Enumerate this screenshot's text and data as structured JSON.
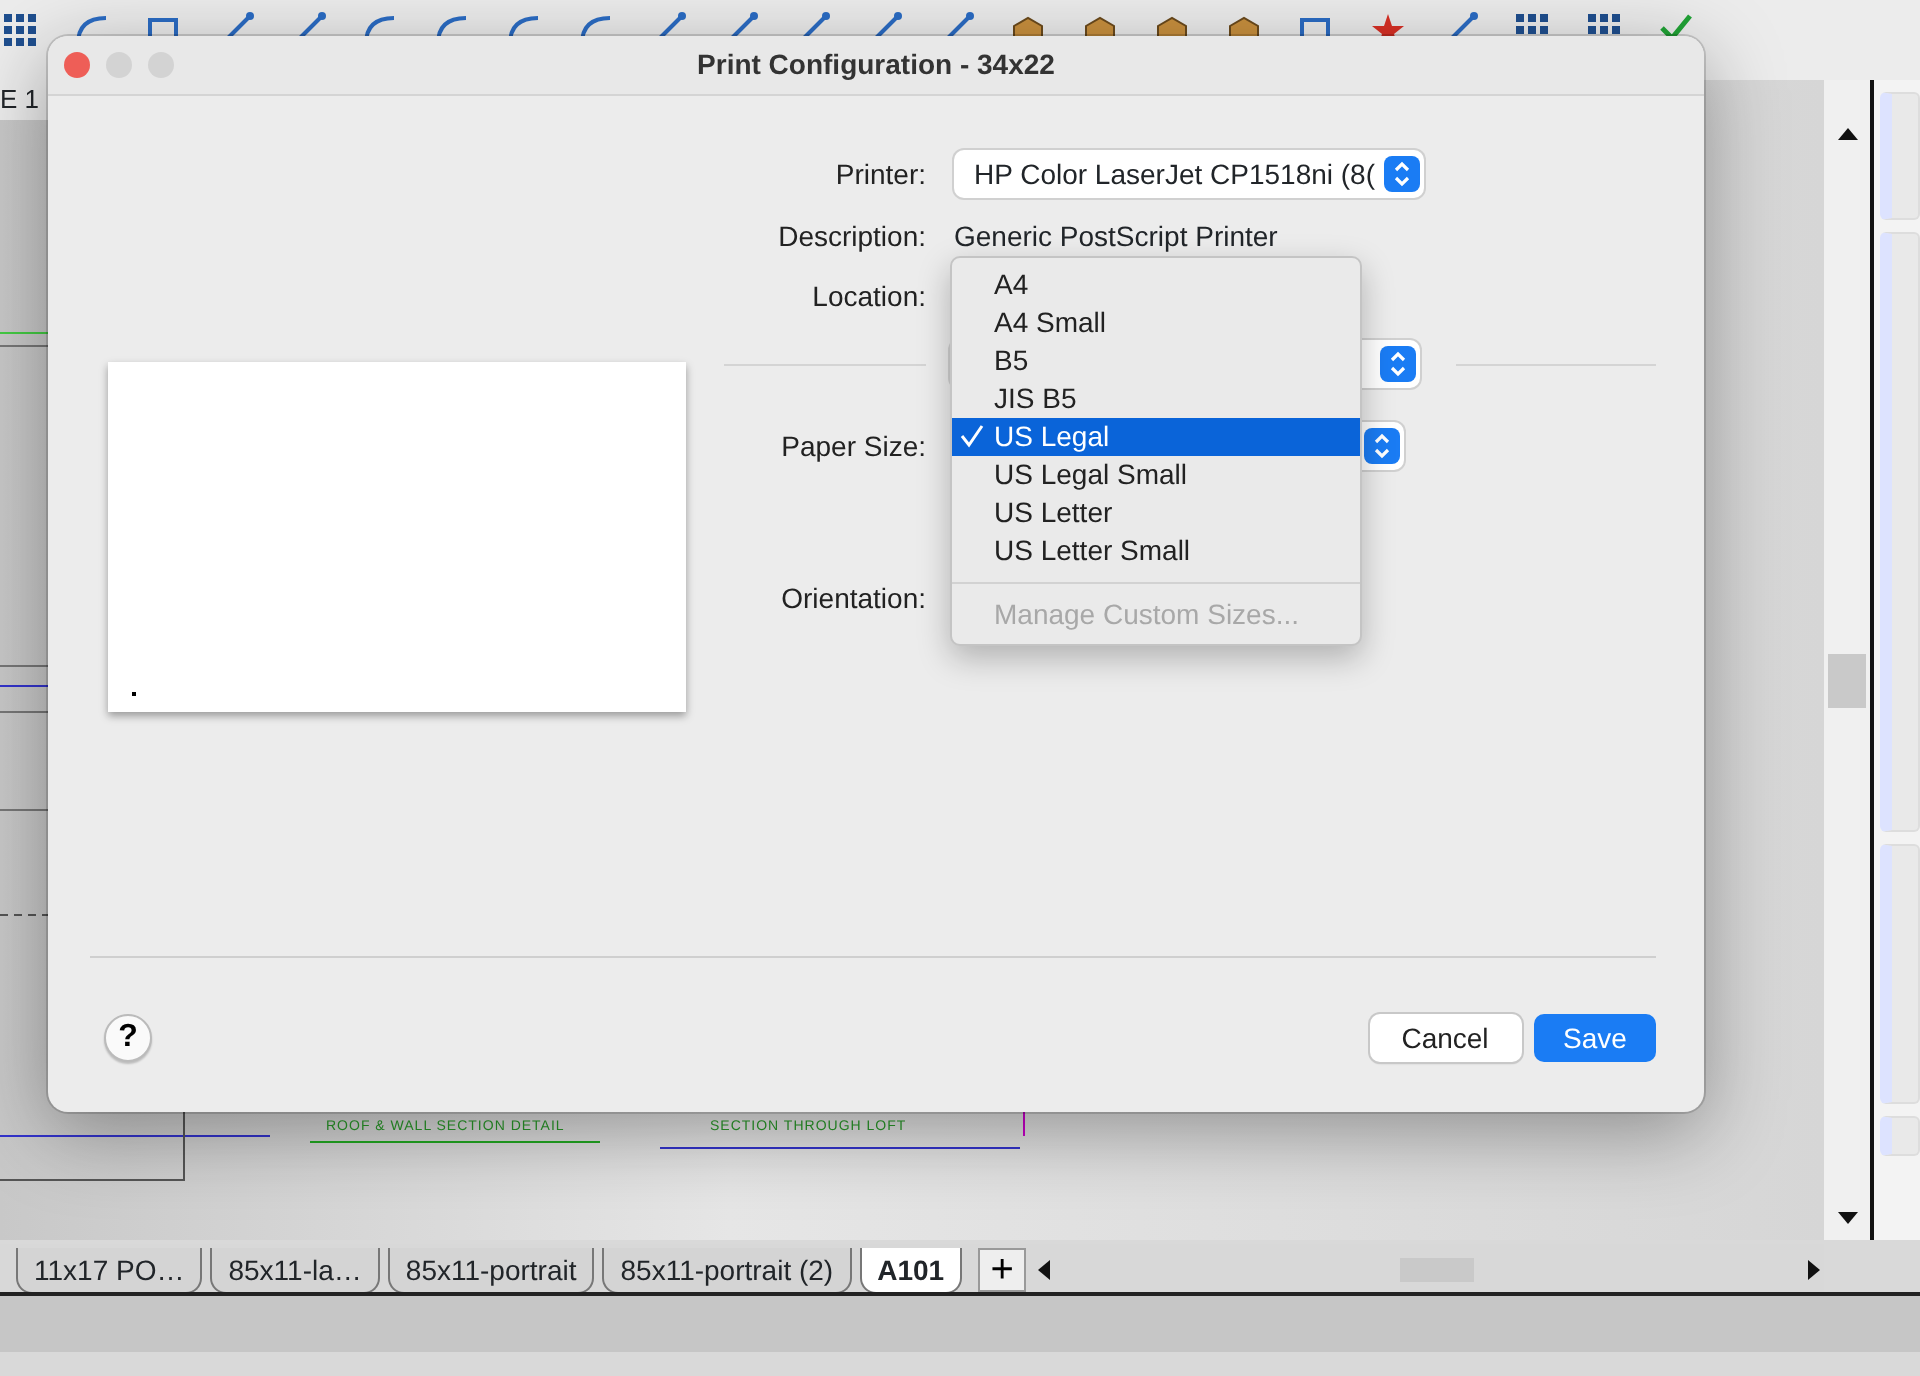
{
  "app": {
    "sheet_label": "E 1",
    "drawing_labels": [
      "ROOF & WALL SECTION DETAIL",
      "SECTION THROUGH LOFT"
    ],
    "sheet_tabs": [
      {
        "label": "11x17 PO…",
        "selected": false
      },
      {
        "label": "85x11-la…",
        "selected": false
      },
      {
        "label": "85x11-portrait",
        "selected": false
      },
      {
        "label": "85x11-portrait (2)",
        "selected": false
      },
      {
        "label": "A101",
        "selected": true
      }
    ],
    "add_tab": "+"
  },
  "dialog": {
    "title": "Print Configuration - 34x22",
    "printer": {
      "label": "Printer:",
      "value": "HP Color LaserJet CP1518ni (8("
    },
    "description": {
      "label": "Description:",
      "value": "Generic PostScript Printer"
    },
    "location": {
      "label": "Location:"
    },
    "paper_size": {
      "label": "Paper Size:"
    },
    "orientation": {
      "label": "Orientation:"
    },
    "paper_menu": [
      {
        "label": "A4",
        "selected": false,
        "disabled": false
      },
      {
        "label": "A4 Small",
        "selected": false,
        "disabled": false
      },
      {
        "label": "B5",
        "selected": false,
        "disabled": false
      },
      {
        "label": "JIS B5",
        "selected": false,
        "disabled": false
      },
      {
        "label": "US Legal",
        "selected": true,
        "disabled": false
      },
      {
        "label": "US Legal Small",
        "selected": false,
        "disabled": false
      },
      {
        "label": "US Letter",
        "selected": false,
        "disabled": false
      },
      {
        "label": "US Letter Small",
        "selected": false,
        "disabled": false
      },
      {
        "kind": "separator"
      },
      {
        "label": "Manage Custom Sizes...",
        "selected": false,
        "disabled": true
      }
    ],
    "help": "?",
    "buttons": [
      {
        "label": "Cancel",
        "kind": "normal"
      },
      {
        "label": "Save",
        "kind": "default"
      }
    ]
  }
}
